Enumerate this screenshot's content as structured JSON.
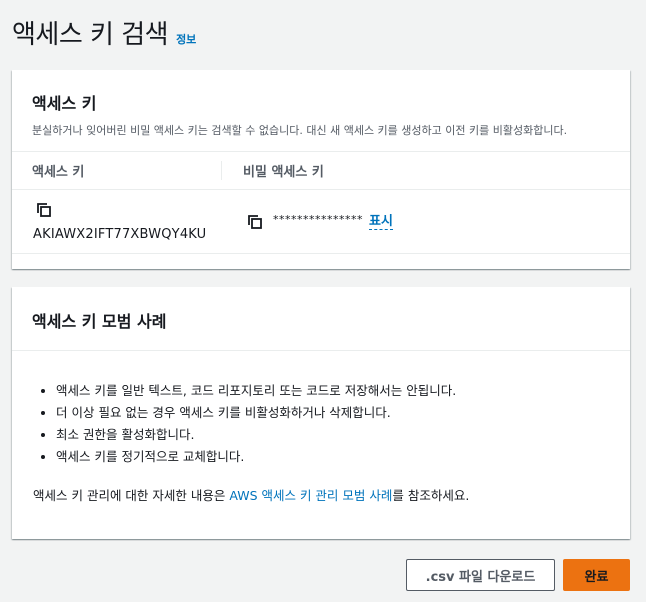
{
  "page": {
    "title": "액세스 키 검색",
    "info_label": "정보"
  },
  "access_key_panel": {
    "title": "액세스 키",
    "description": "분실하거나 잊어버린 비밀 액세스 키는 검색할 수 없습니다. 대신 새 액세스 키를 생성하고 이전 키를 비활성화합니다.",
    "columns": [
      "액세스 키",
      "비밀 액세스 키"
    ],
    "access_key_id": "AKIAWX2IFT77XBWQY4KU",
    "secret_masked": "***************",
    "show_label": "표시"
  },
  "best_practices_panel": {
    "title": "액세스 키 모범 사례",
    "items": [
      "액세스 키를 일반 텍스트, 코드 리포지토리 또는 코드로 저장해서는 안됩니다.",
      "더 이상 필요 없는 경우 액세스 키를 비활성화하거나 삭제합니다.",
      "최소 권한을 활성화합니다.",
      "액세스 키를 정기적으로 교체합니다."
    ],
    "reference_prefix": "액세스 키 관리에 대한 자세한 내용은 ",
    "reference_link": "AWS 액세스 키 관리 모범 사례",
    "reference_suffix": "를 참조하세요."
  },
  "footer": {
    "download_label": ".csv 파일 다운로드",
    "done_label": "완료"
  },
  "colors": {
    "link": "#0073bb",
    "primary_button": "#ec7211",
    "background": "#f2f3f3"
  },
  "icons": [
    "copy-icon"
  ]
}
